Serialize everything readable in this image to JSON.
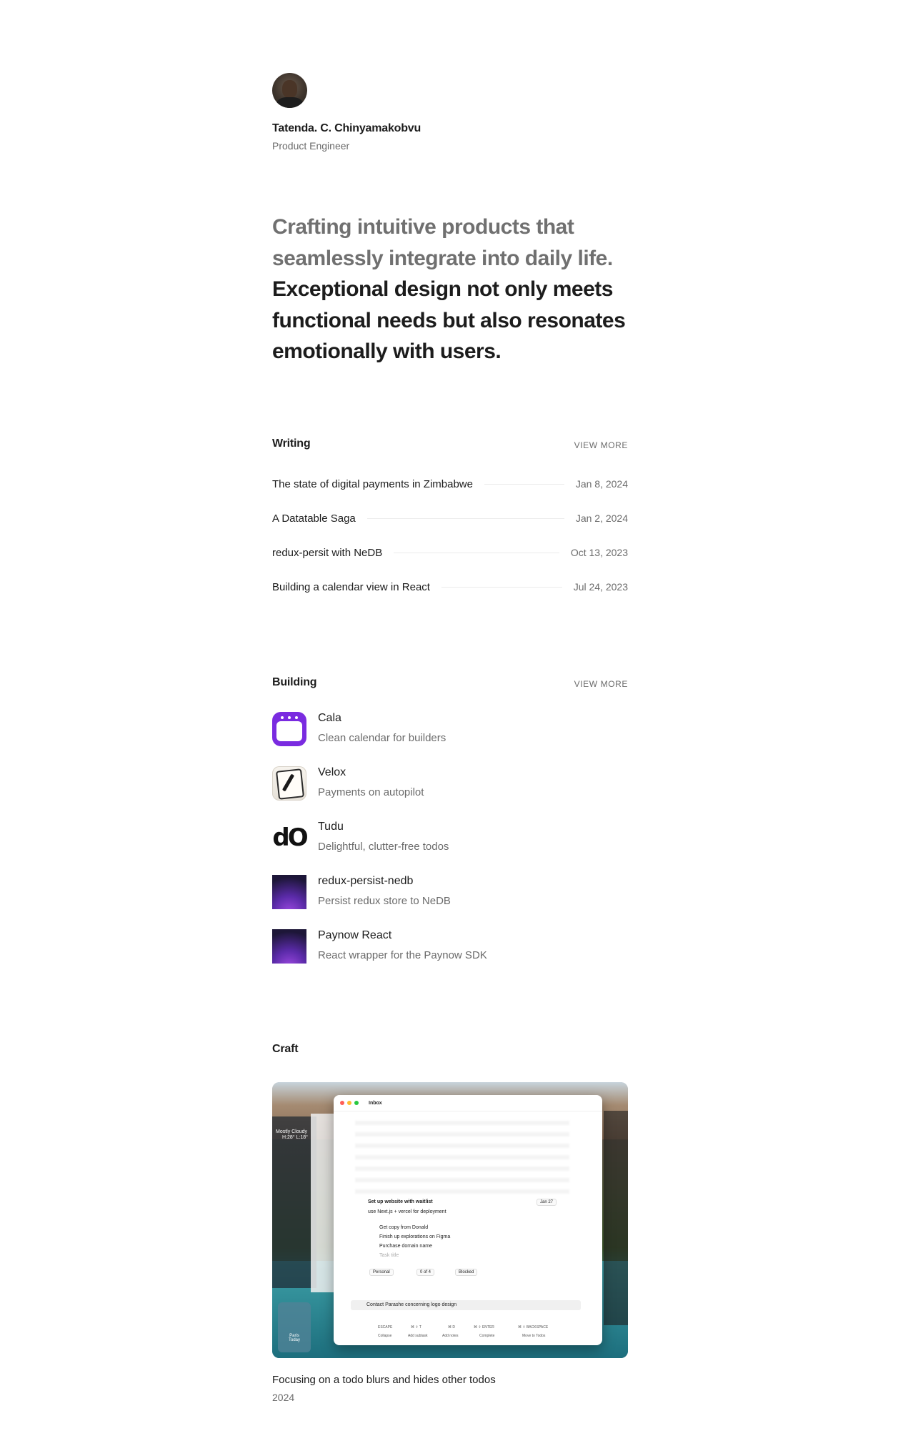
{
  "profile": {
    "name": "Tatenda. C. Chinyamakobvu",
    "role": "Product Engineer"
  },
  "hero": {
    "muted": "Crafting intuitive products that seamlessly integrate into daily life.",
    "strong": "Exceptional design not only meets functional needs but also resonates emotionally with users."
  },
  "writing": {
    "title": "Writing",
    "view_more": "VIEW MORE",
    "posts": [
      {
        "title": "The state of digital payments in Zimbabwe",
        "date": "Jan 8, 2024"
      },
      {
        "title": "A Datatable Saga",
        "date": "Jan 2, 2024"
      },
      {
        "title": "redux-persit with NeDB",
        "date": "Oct 13, 2023"
      },
      {
        "title": "Building a calendar view in React",
        "date": "Jul 24, 2023"
      }
    ]
  },
  "building": {
    "title": "Building",
    "view_more": "VIEW MORE",
    "projects": [
      {
        "name": "Cala",
        "desc": "Clean calendar for builders",
        "icon": "calendar-app-icon"
      },
      {
        "name": "Velox",
        "desc": "Payments on autopilot",
        "icon": "pen-paper-app-icon"
      },
      {
        "name": "Tudu",
        "desc": "Delightful, clutter-free todos",
        "icon": "tudu-logo-icon",
        "logo_text": "dO"
      },
      {
        "name": "redux-persist-nedb",
        "desc": "Persist redux store to NeDB",
        "icon": "gradient-icon"
      },
      {
        "name": "Paynow React",
        "desc": "React wrapper for the Paynow SDK",
        "icon": "gradient-icon"
      }
    ]
  },
  "craft": {
    "title": "Craft",
    "caption": "Focusing on a todo blurs and hides other todos",
    "year": "2024",
    "screenshot": {
      "window_title": "Inbox",
      "weather": "Mostly Cloudy",
      "weather_range": "H:28° L:18°",
      "clock_city": "Paris",
      "clock_sub": "Today",
      "task_title": "Set up website with waitlist",
      "task_note": "use Next.js + vercel for deployment",
      "task_date": "Jan 27",
      "subtasks": [
        "Get copy from Donald",
        "Finish up explorations on Figma",
        "Purchase domain name",
        "Task title"
      ],
      "chips": [
        "Personal",
        "0 of 4",
        "Blocked"
      ],
      "focus_task": "Contact Parashe concerning logo design",
      "shortcuts": [
        {
          "key": "ESCAPE",
          "label": "Collapse"
        },
        {
          "key": "⌘ ⇧ T",
          "label": "Add subtask"
        },
        {
          "key": "⌘ D",
          "label": "Add notes"
        },
        {
          "key": "⌘ ⇧ ENTER",
          "label": "Complete"
        },
        {
          "key": "⌘ ⇧ BACKSPACE",
          "label": "Move to Todos"
        }
      ]
    }
  },
  "colors": {
    "text": "#1c1c1c",
    "muted": "#707070",
    "cala_purple": "#7a2be0"
  }
}
